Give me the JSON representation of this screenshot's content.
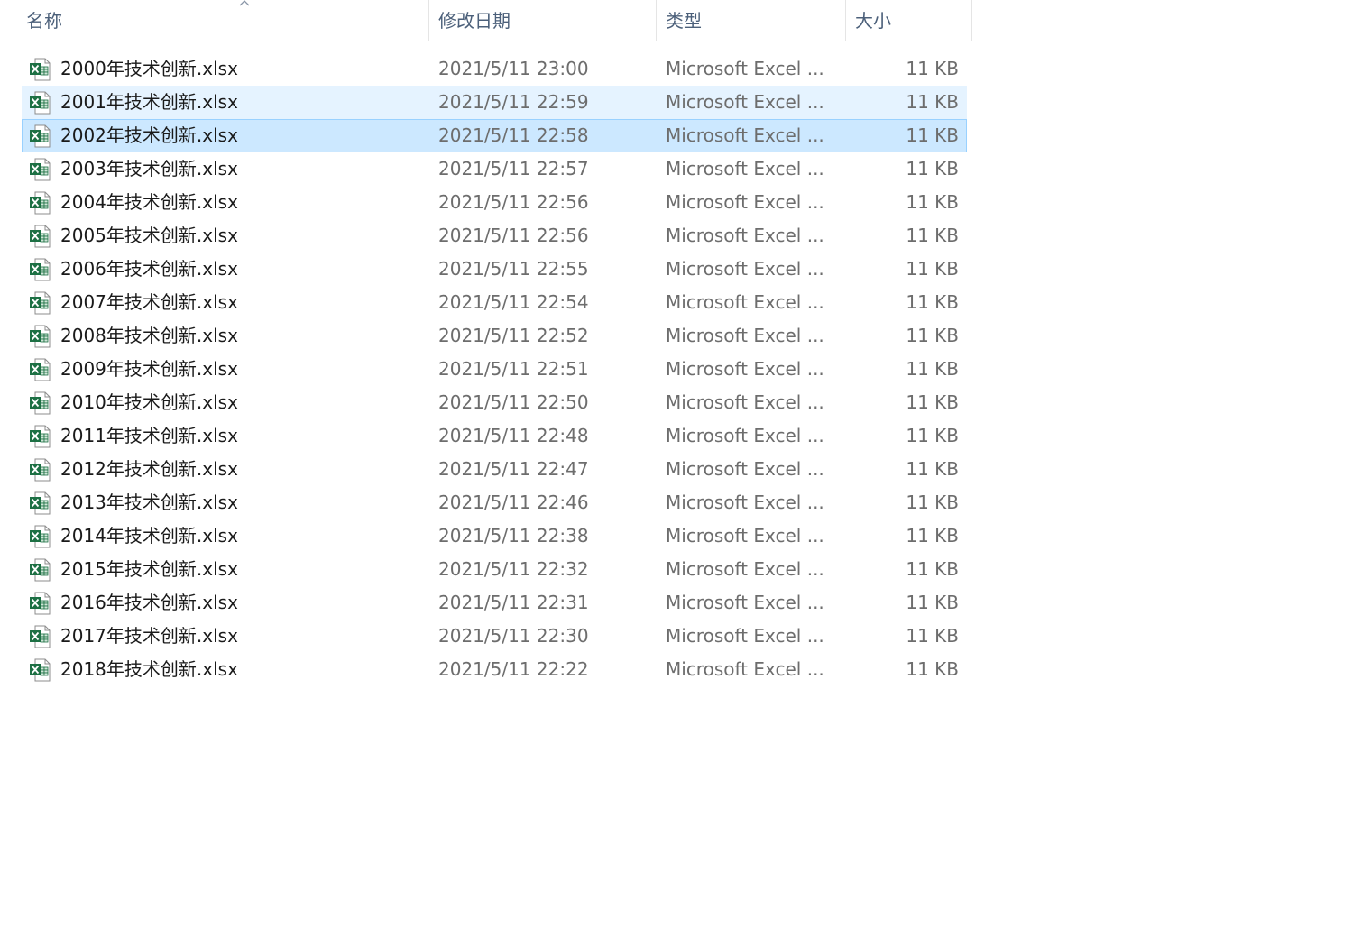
{
  "columns": {
    "name": "名称",
    "date": "修改日期",
    "type": "类型",
    "size": "大小"
  },
  "icon": "excel-file-icon",
  "colors": {
    "hover_bg": "#e5f3ff",
    "selected_bg": "#cce8ff",
    "selected_border": "#99d1ff",
    "excel_green": "#1d7044"
  },
  "files": [
    {
      "name": "2000年技术创新.xlsx",
      "date": "2021/5/11 23:00",
      "type": "Microsoft Excel ...",
      "size": "11 KB",
      "state": ""
    },
    {
      "name": "2001年技术创新.xlsx",
      "date": "2021/5/11 22:59",
      "type": "Microsoft Excel ...",
      "size": "11 KB",
      "state": "hover"
    },
    {
      "name": "2002年技术创新.xlsx",
      "date": "2021/5/11 22:58",
      "type": "Microsoft Excel ...",
      "size": "11 KB",
      "state": "selected"
    },
    {
      "name": "2003年技术创新.xlsx",
      "date": "2021/5/11 22:57",
      "type": "Microsoft Excel ...",
      "size": "11 KB",
      "state": ""
    },
    {
      "name": "2004年技术创新.xlsx",
      "date": "2021/5/11 22:56",
      "type": "Microsoft Excel ...",
      "size": "11 KB",
      "state": ""
    },
    {
      "name": "2005年技术创新.xlsx",
      "date": "2021/5/11 22:56",
      "type": "Microsoft Excel ...",
      "size": "11 KB",
      "state": ""
    },
    {
      "name": "2006年技术创新.xlsx",
      "date": "2021/5/11 22:55",
      "type": "Microsoft Excel ...",
      "size": "11 KB",
      "state": ""
    },
    {
      "name": "2007年技术创新.xlsx",
      "date": "2021/5/11 22:54",
      "type": "Microsoft Excel ...",
      "size": "11 KB",
      "state": ""
    },
    {
      "name": "2008年技术创新.xlsx",
      "date": "2021/5/11 22:52",
      "type": "Microsoft Excel ...",
      "size": "11 KB",
      "state": ""
    },
    {
      "name": "2009年技术创新.xlsx",
      "date": "2021/5/11 22:51",
      "type": "Microsoft Excel ...",
      "size": "11 KB",
      "state": ""
    },
    {
      "name": "2010年技术创新.xlsx",
      "date": "2021/5/11 22:50",
      "type": "Microsoft Excel ...",
      "size": "11 KB",
      "state": ""
    },
    {
      "name": "2011年技术创新.xlsx",
      "date": "2021/5/11 22:48",
      "type": "Microsoft Excel ...",
      "size": "11 KB",
      "state": ""
    },
    {
      "name": "2012年技术创新.xlsx",
      "date": "2021/5/11 22:47",
      "type": "Microsoft Excel ...",
      "size": "11 KB",
      "state": ""
    },
    {
      "name": "2013年技术创新.xlsx",
      "date": "2021/5/11 22:46",
      "type": "Microsoft Excel ...",
      "size": "11 KB",
      "state": ""
    },
    {
      "name": "2014年技术创新.xlsx",
      "date": "2021/5/11 22:38",
      "type": "Microsoft Excel ...",
      "size": "11 KB",
      "state": ""
    },
    {
      "name": "2015年技术创新.xlsx",
      "date": "2021/5/11 22:32",
      "type": "Microsoft Excel ...",
      "size": "11 KB",
      "state": ""
    },
    {
      "name": "2016年技术创新.xlsx",
      "date": "2021/5/11 22:31",
      "type": "Microsoft Excel ...",
      "size": "11 KB",
      "state": ""
    },
    {
      "name": "2017年技术创新.xlsx",
      "date": "2021/5/11 22:30",
      "type": "Microsoft Excel ...",
      "size": "11 KB",
      "state": ""
    },
    {
      "name": "2018年技术创新.xlsx",
      "date": "2021/5/11 22:22",
      "type": "Microsoft Excel ...",
      "size": "11 KB",
      "state": ""
    }
  ]
}
